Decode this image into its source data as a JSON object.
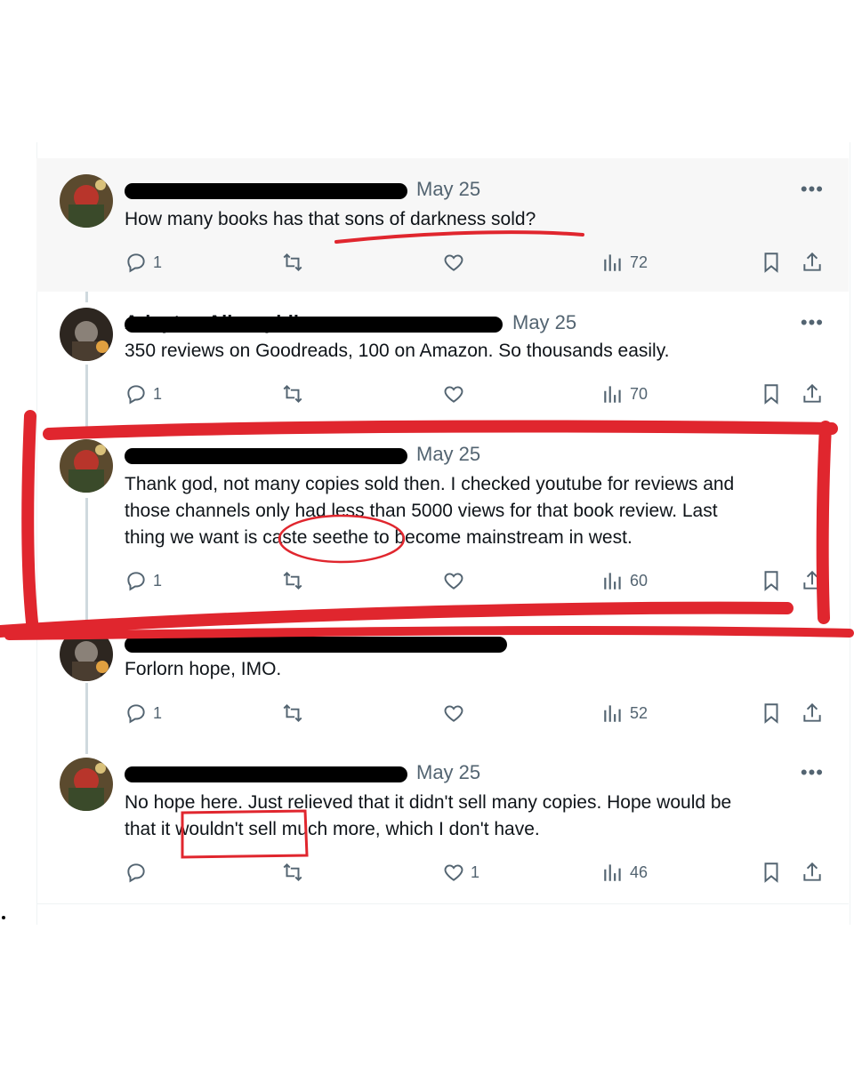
{
  "tweets": [
    {
      "date": "May 25",
      "text": "How many books has that sons of darkness sold?",
      "replies": "1",
      "retweets": "",
      "likes": "",
      "views": "72",
      "highlighted": true
    },
    {
      "name": "Adeptus Ailurophile",
      "date": "May 25",
      "text": "350 reviews on Goodreads, 100 on Amazon. So thousands easily.",
      "replies": "1",
      "retweets": "",
      "likes": "",
      "views": "70"
    },
    {
      "date": "May 25",
      "text_line1": "Thank god, not many copies sold then. I checked youtube for reviews and",
      "text_line2": "those channels only had less than 5000 views for that book review. Last",
      "text_line3": "thing we want is caste seethe to become mainstream in west.",
      "replies": "1",
      "retweets": "",
      "likes": "",
      "views": "60"
    },
    {
      "text": "Forlorn hope, IMO.",
      "replies": "1",
      "retweets": "",
      "likes": "",
      "views": "52"
    },
    {
      "date": "May 25",
      "text_line1": "No hope here. Just relieved that it didn't sell many copies. Hope would be",
      "text_line2": "that it wouldn't sell much more, which I don't have.",
      "replies": "",
      "retweets": "",
      "likes": "1",
      "views": "46"
    }
  ],
  "more_icon": "•••",
  "icons": [
    "reply-icon",
    "retweet-icon",
    "like-icon",
    "views-icon",
    "bookmark-icon",
    "share-icon"
  ],
  "colors": {
    "annotation_red": "#e0262e",
    "muted": "#536471",
    "thread_line": "#cfd9de",
    "highlight_bg": "#f7f7f7"
  }
}
